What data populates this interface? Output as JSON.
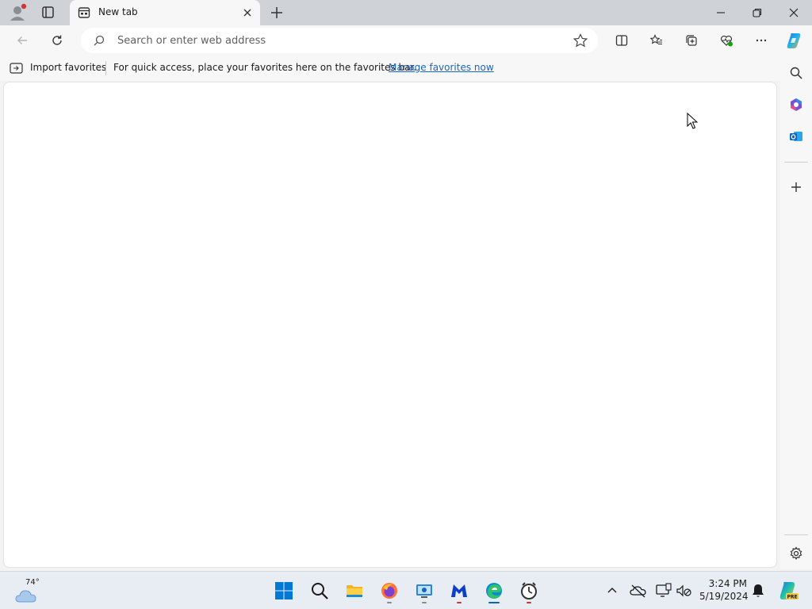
{
  "browser": {
    "tab": {
      "title": "New tab"
    },
    "address_bar": {
      "placeholder": "Search or enter web address"
    },
    "favorites_bar": {
      "import_label": "Import favorites",
      "message": "For quick access, place your favorites here on the favorites bar.",
      "manage_link": "Manage favorites now"
    }
  },
  "taskbar": {
    "weather": {
      "temp": "74°"
    },
    "clock": {
      "time": "3:24 PM",
      "date": "5/19/2024"
    },
    "pinned_apps": [
      "start-icon",
      "search-icon",
      "file-explorer-icon",
      "firefox-icon",
      "remote-desktop-icon",
      "malwarebytes-icon",
      "edge-icon",
      "clock-app-icon"
    ],
    "copilot_badge": "PRE"
  },
  "colors": {
    "accent": "#1a66c2",
    "tabstrip": "#cfd3d8",
    "toolbar": "#f7f7f7",
    "taskbar": "#e8edf3",
    "notification_dot": "#d13438"
  }
}
